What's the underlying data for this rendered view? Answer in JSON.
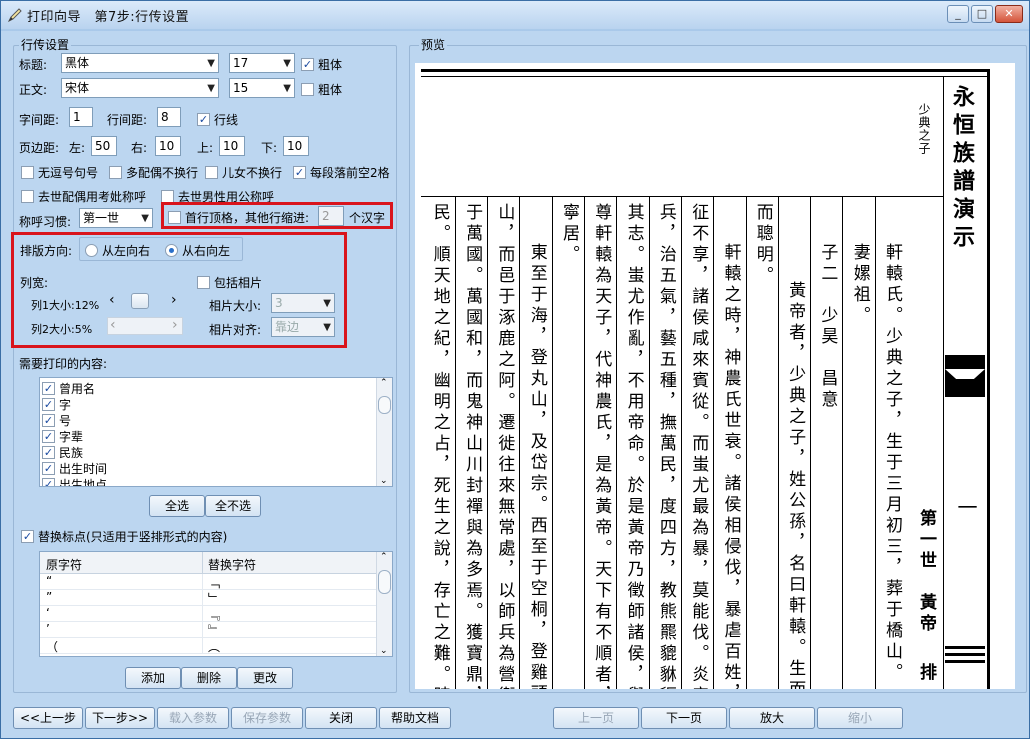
{
  "window": {
    "title": "打印向导　第7步:行传设置",
    "min": "_",
    "max": "□",
    "close": "✕"
  },
  "left": {
    "group_title": "行传设置",
    "title_label": "标题:",
    "title_font": "黑体",
    "title_size": "17",
    "title_bold": "粗体",
    "body_label": "正文:",
    "body_font": "宋体",
    "body_size": "15",
    "body_bold": "粗体",
    "char_spacing_label": "字间距:",
    "char_spacing": "1",
    "line_spacing_label": "行间距:",
    "line_spacing": "8",
    "row_line": "行线",
    "margin_label": "页边距:",
    "margin_left_label": "左:",
    "margin_left": "50",
    "margin_right_label": "右:",
    "margin_right": "10",
    "margin_top_label": "上:",
    "margin_top": "10",
    "margin_bottom_label": "下:",
    "margin_bottom": "10",
    "opt1": "无逗号句号",
    "opt2": "多配偶不换行",
    "opt3": "儿女不换行",
    "opt4": "每段落前空2格",
    "opt5": "去世配偶用考妣称呼",
    "opt6": "去世男性用公称呼",
    "address_label": "称呼习惯:",
    "address_value": "第一世",
    "indent_label": "首行顶格，其他行缩进:",
    "indent_value": "2",
    "indent_unit": "个汉字",
    "layout_dir_label": "排版方向:",
    "dir_ltr": "从左向右",
    "dir_rtl": "从右向左",
    "col_width_label": "列宽:",
    "include_photo": "包括相片",
    "col1_label": "列1大小:12%",
    "col2_label": "列2大小:5%",
    "photo_size_label": "相片大小:",
    "photo_size_value": "3",
    "photo_align_label": "相片对齐:",
    "photo_align_value": "靠边",
    "print_content_label": "需要打印的内容:",
    "content_items": [
      "曾用名",
      "字",
      "号",
      "字辈",
      "民族",
      "出生时间",
      "出生地点"
    ],
    "select_all": "全选",
    "select_none": "全不选",
    "replace_punct": "替换标点(只适用于竖排形式的内容)",
    "table_headers": [
      "原字符",
      "替换字符"
    ],
    "table_rows": [
      [
        "“",
        "﹁"
      ],
      [
        "”",
        "﹂"
      ],
      [
        "‘",
        "﹃"
      ],
      [
        "’",
        "﹄"
      ],
      [
        "（",
        "︵"
      ]
    ],
    "add": "添加",
    "delete": "删除",
    "change": "更改"
  },
  "preview": {
    "label": "预览",
    "book_title": "永恒族譜演示",
    "generation": "第一世",
    "name": "黃帝",
    "tag": "排",
    "section_num": "一",
    "header_note": "少典之子",
    "columns": [
      "軒轅氏。少典之子，生于三月初三，葬于橋山。",
      "妻嫘祖。",
      "子二　少昊　昌意",
      "黃帝者，少典之子，姓公孫，名曰軒轅。生而神",
      "而聰明。",
      "軒轅之時，神農氏世衰。諸侯相侵伐，暴虐百姓，而",
      "征不享，諸侯咸來賓從。而蚩尤最為暴，莫能伐。炎帝欲",
      "兵，治五氣，藝五種，撫萬民，度四方，教熊羆貔貅貙虎",
      "其志。蚩尤作亂，不用帝命。於是黃帝乃徵師諸侯，與蚩",
      "尊軒轅為天子，代神農氏，是為黃帝。天下有不順者，黃",
      "寧居。",
      "東至于海，登丸山，及岱宗。西至于空桐，登雞頭。",
      "山，而邑于涿鹿之阿。遷徙往來無常處，以師兵為營衛。",
      "于萬國。萬國和，而鬼神山川封禪與為多焉。獲寶鼎，迎",
      "民。順天地之紀，幽明之占，死生之說，存亡之難。時播"
    ]
  },
  "footer": {
    "prev_step": "<<上一步",
    "next_step": "下一步>>",
    "load_params": "载入参数",
    "save_params": "保存参数",
    "close": "关闭",
    "help": "帮助文档",
    "prev_page": "上一页",
    "next_page": "下一页",
    "zoom_in": "放大",
    "zoom_out": "缩小"
  }
}
